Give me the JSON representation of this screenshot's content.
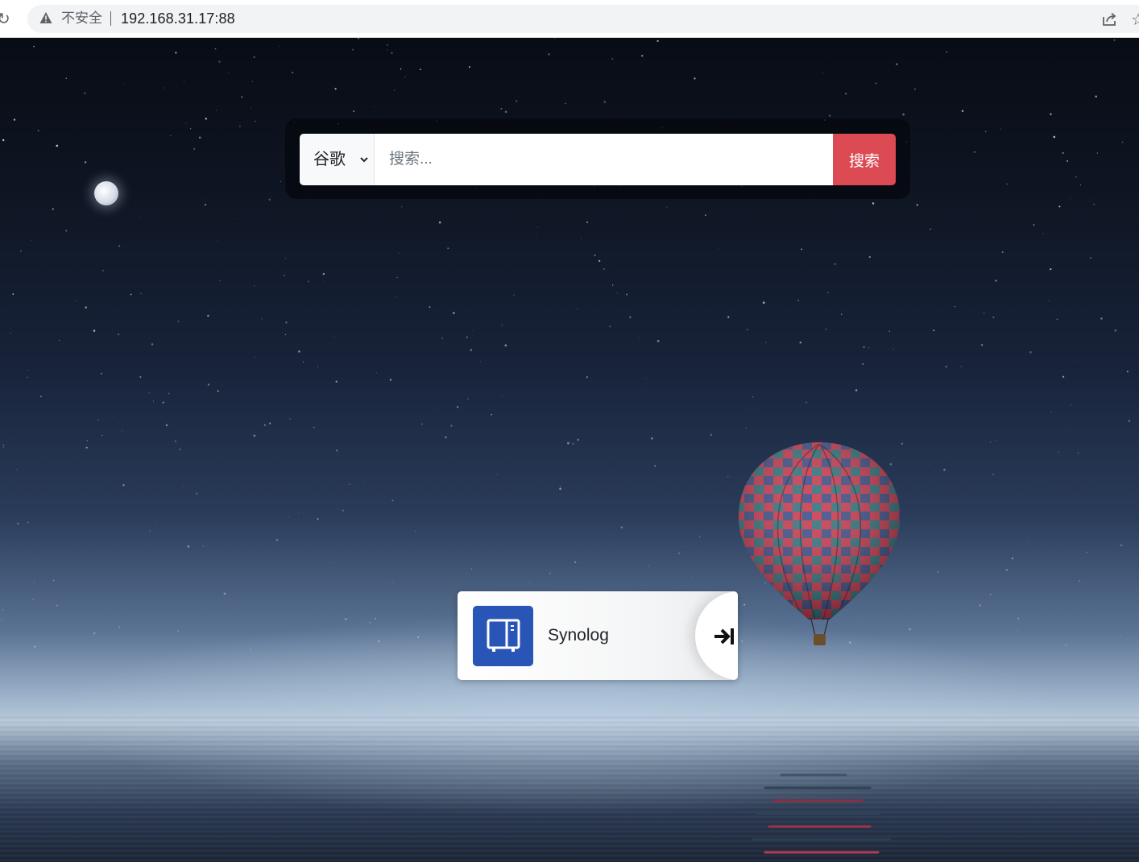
{
  "browser": {
    "security_label": "不安全",
    "url": "192.168.31.17:88"
  },
  "search": {
    "engine": "谷歌",
    "placeholder": "搜索...",
    "button_label": "搜索",
    "button_color": "#dc4a53"
  },
  "apps": [
    {
      "name": "Synolog",
      "icon": "nas-server-icon",
      "action_icon": "enter-arrow-icon",
      "icon_color": "#2955b6"
    }
  ]
}
